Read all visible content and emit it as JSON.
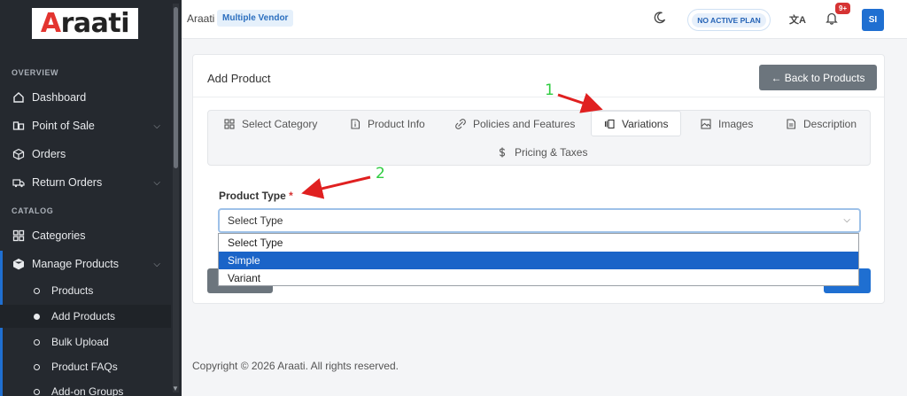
{
  "brand": {
    "logo": "Araati"
  },
  "sidebar": {
    "sections": {
      "overview": "OVERVIEW",
      "catalog": "CATALOG"
    },
    "items": [
      {
        "label": "Dashboard"
      },
      {
        "label": "Point of Sale"
      },
      {
        "label": "Orders"
      },
      {
        "label": "Return Orders"
      },
      {
        "label": "Categories"
      },
      {
        "label": "Manage Products"
      }
    ],
    "sub_items": [
      {
        "label": "Products"
      },
      {
        "label": "Add Products"
      },
      {
        "label": "Bulk Upload"
      },
      {
        "label": "Product FAQs"
      },
      {
        "label": "Add-on Groups"
      }
    ]
  },
  "topbar": {
    "title": "Araati",
    "vendor_badge": "Multiple Vendor",
    "plan": "NO ACTIVE PLAN",
    "notifications": "9+",
    "avatar": "SI"
  },
  "page": {
    "title": "Add Product",
    "back_button": "← Back to Products",
    "tabs": [
      {
        "label": "Select Category",
        "icon": "grid-icon"
      },
      {
        "label": "Product Info",
        "icon": "info-doc-icon"
      },
      {
        "label": "Policies and Features",
        "icon": "link-icon"
      },
      {
        "label": "Variations",
        "icon": "variations-icon",
        "active": true
      },
      {
        "label": "Images",
        "icon": "image-icon"
      },
      {
        "label": "Description",
        "icon": "document-icon"
      },
      {
        "label": "Pricing & Taxes",
        "icon": "dollar-icon"
      }
    ],
    "product_type": {
      "label": "Product Type",
      "required_mark": "*",
      "value": "Select Type",
      "options": [
        "Select Type",
        "Simple",
        "Variant"
      ],
      "highlighted": "Simple"
    }
  },
  "footer": {
    "copyright": "Copyright © 2026 Araati. All rights reserved."
  },
  "annotations": {
    "one": "1",
    "two": "2"
  },
  "colors": {
    "sidebar_bg": "#25292f",
    "primary": "#1f6fd1",
    "annotation_arrow": "#e02020",
    "annotation_number": "#2ecc40"
  }
}
